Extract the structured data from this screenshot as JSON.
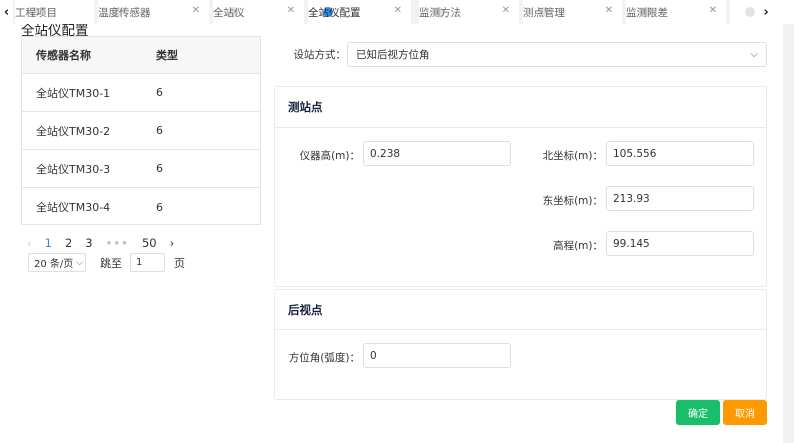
{
  "tabs": [
    {
      "label": "工程项目",
      "active": false,
      "closable": false
    },
    {
      "label": "温度传感器",
      "active": false,
      "closable": true
    },
    {
      "label": "全站仪",
      "active": false,
      "closable": true
    },
    {
      "label": "全站仪配置",
      "active": true,
      "closable": true
    },
    {
      "label": "监测方法",
      "active": false,
      "closable": true
    },
    {
      "label": "测点管理",
      "active": false,
      "closable": true
    },
    {
      "label": "监测限差",
      "active": false,
      "closable": true
    }
  ],
  "page_title": "全站仪配置",
  "sensor_table": {
    "headers": [
      "传感器名称",
      "类型"
    ],
    "rows": [
      [
        "全站仪TM30-1",
        "6"
      ],
      [
        "全站仪TM30-2",
        "6"
      ],
      [
        "全站仪TM30-3",
        "6"
      ],
      [
        "全站仪TM30-4",
        "6"
      ]
    ]
  },
  "pagination": {
    "prev": "‹",
    "pages": [
      "1",
      "2",
      "3"
    ],
    "ellipsis": "•••",
    "last_page": "50",
    "next": "›",
    "page_size": "20 条/页",
    "jump_label": "跳至",
    "jump_value": "1",
    "jump_suffix": "页"
  },
  "station_mode": {
    "label": "设站方式：",
    "value": "已知后视方位角"
  },
  "station_point": {
    "title": "测站点",
    "instrument_height_label": "仪器高(m)：",
    "instrument_height": "0.238",
    "north_label": "北坐标(m)：",
    "north": "105.556",
    "east_label": "东坐标(m)：",
    "east": "213.93",
    "elevation_label": "高程(m)：",
    "elevation": "99.145"
  },
  "backsight_point": {
    "title": "后视点",
    "azimuth_label": "方位角(弧度)：",
    "azimuth": "0"
  },
  "buttons": {
    "ok": "确定",
    "cancel": "取消"
  },
  "colors": {
    "accent": "#2d8cf0",
    "ok": "#19be6b",
    "cancel": "#ff9900"
  }
}
